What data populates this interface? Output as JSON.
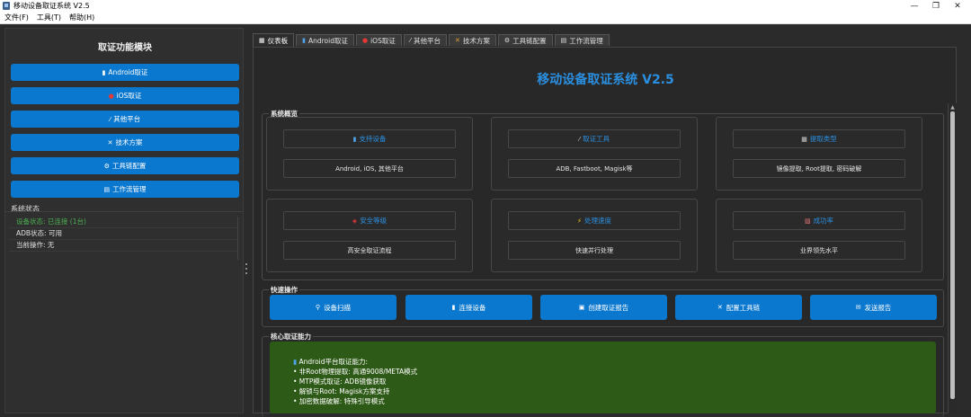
{
  "window": {
    "title": "移动设备取证系统 V2.5",
    "controls": {
      "minimize": "—",
      "maximize": "❐",
      "close": "✕"
    }
  },
  "menubar": [
    {
      "label": "文件(F)"
    },
    {
      "label": "工具(T)"
    },
    {
      "label": "帮助(H)"
    }
  ],
  "sidebar": {
    "title": "取证功能模块",
    "buttons": [
      {
        "icon": "phone-icon",
        "glyph": "▮",
        "label": "Android取证"
      },
      {
        "icon": "apple-icon",
        "glyph": "●",
        "label": "iOS取证"
      },
      {
        "icon": "wrench-icon",
        "glyph": "⁄",
        "label": "其他平台"
      },
      {
        "icon": "tools-icon",
        "glyph": "✕",
        "label": "技术方案"
      },
      {
        "icon": "gear-icon",
        "glyph": "⚙",
        "label": "工具链配置"
      },
      {
        "icon": "clipboard-icon",
        "glyph": "▤",
        "label": "工作流管理"
      }
    ],
    "status_title": "系统状态",
    "status": [
      {
        "label": "设备状态: 已连接 (1台)",
        "color": "#4caf50"
      },
      {
        "label": "ADB状态: 可用",
        "color": "#e0e0e0"
      },
      {
        "label": "当前操作: 无",
        "color": "#e0e0e0"
      }
    ]
  },
  "tabs": [
    {
      "icon": "chart-icon",
      "glyph": "▦",
      "label": "仪表板",
      "active": true
    },
    {
      "icon": "phone-icon",
      "glyph": "▮",
      "label": "Android取证",
      "active": false
    },
    {
      "icon": "apple-icon",
      "glyph": "●",
      "label": "iOS取证",
      "active": false
    },
    {
      "icon": "wrench-icon",
      "glyph": "⁄",
      "label": "其他平台",
      "active": false
    },
    {
      "icon": "tools-icon",
      "glyph": "✕",
      "label": "技术方案",
      "active": false
    },
    {
      "icon": "gear-icon",
      "glyph": "⚙",
      "label": "工具链配置",
      "active": false
    },
    {
      "icon": "clipboard-icon",
      "glyph": "▤",
      "label": "工作流管理",
      "active": false
    }
  ],
  "dashboard": {
    "title": "移动设备取证系统 V2.5",
    "overview_title": "系统概览",
    "cards": [
      {
        "icon": "phone-icon",
        "glyph": "▮",
        "title": "支持设备",
        "value": "Android, iOS, 其他平台"
      },
      {
        "icon": "wrench-icon",
        "glyph": "⁄",
        "title": "取证工具",
        "value": "ADB, Fastboot, Magisk等"
      },
      {
        "icon": "chart-icon",
        "glyph": "▦",
        "title": "提取类型",
        "value": "镜像提取, Root提取, 密码破解"
      },
      {
        "icon": "shield-icon",
        "glyph": "◈",
        "title": "安全等级",
        "value": "高安全取证流程"
      },
      {
        "icon": "lightning-icon",
        "glyph": "⚡",
        "title": "处理速度",
        "value": "快速并行处理"
      },
      {
        "icon": "trend-icon",
        "glyph": "▨",
        "title": "成功率",
        "value": "业界领先水平"
      }
    ],
    "quick_title": "快速操作",
    "quick_actions": [
      {
        "icon": "search-icon",
        "glyph": "⚲",
        "label": "设备扫描"
      },
      {
        "icon": "phone-icon",
        "glyph": "▮",
        "label": "连接设备"
      },
      {
        "icon": "report-icon",
        "glyph": "▣",
        "label": "创建取证报告"
      },
      {
        "icon": "tools-icon",
        "glyph": "✕",
        "label": "配置工具链"
      },
      {
        "icon": "mail-icon",
        "glyph": "✉",
        "label": "发送报告"
      }
    ],
    "capability_title": "核心取证能力",
    "capabilities": {
      "heading_icon": "phone-icon",
      "heading_glyph": "▮",
      "heading": "Android平台取证能力:",
      "lines": [
        "• 非Root物理提取: 高通9008/META模式",
        "• MTP模式取证: ADB镜像获取",
        "• 解锁与Root: Magisk方案支持",
        "• 加密数据破解: 特殊引导模式"
      ]
    }
  },
  "colors": {
    "accent_blue": "#0b78cf",
    "title_blue": "#2a8fe0",
    "status_green": "#4caf50",
    "capability_bg": "#2e5a17"
  }
}
